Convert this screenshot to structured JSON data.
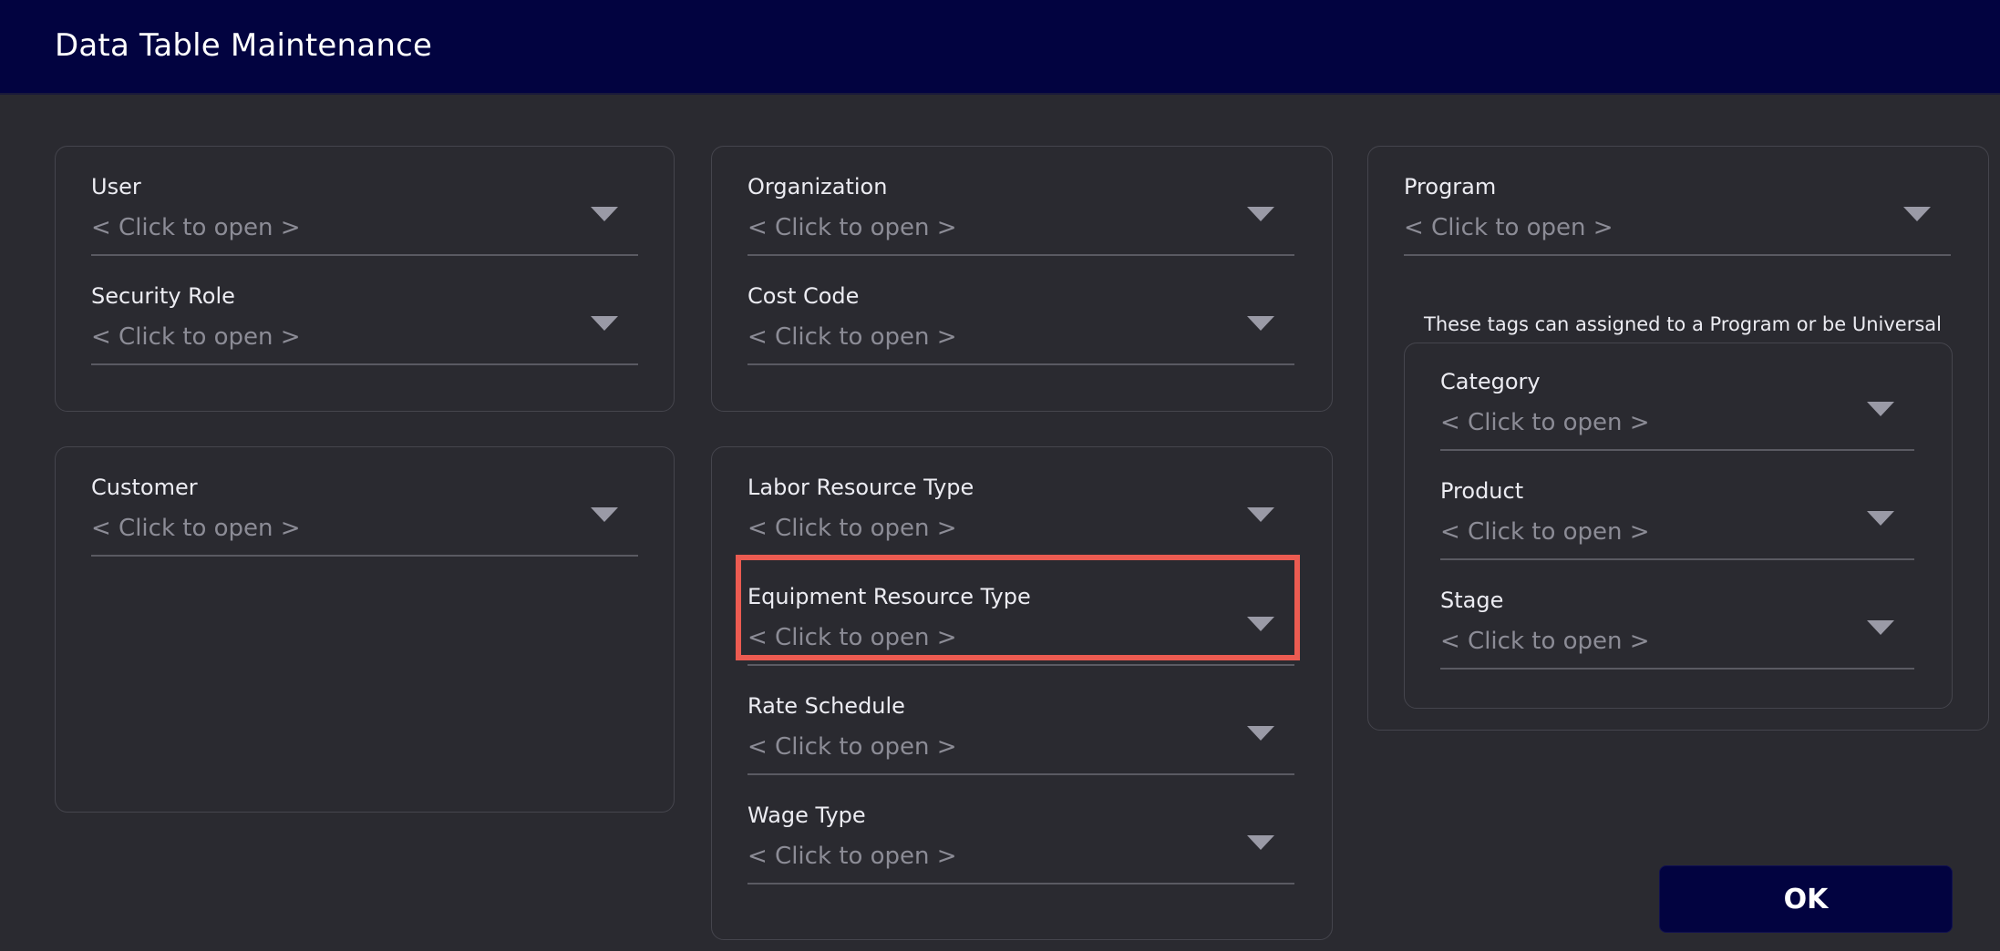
{
  "dialog": {
    "title": "Data Table Maintenance"
  },
  "fields": {
    "user": {
      "label": "User",
      "value": "< Click to open >"
    },
    "security_role": {
      "label": "Security Role",
      "value": "< Click to open >"
    },
    "customer": {
      "label": "Customer",
      "value": "< Click to open >"
    },
    "organization": {
      "label": "Organization",
      "value": "< Click to open >"
    },
    "cost_code": {
      "label": "Cost Code",
      "value": "< Click to open >"
    },
    "labor_resource_type": {
      "label": "Labor Resource Type",
      "value": "< Click to open >"
    },
    "equipment_resource_type": {
      "label": "Equipment Resource Type",
      "value": "< Click to open >"
    },
    "rate_schedule": {
      "label": "Rate Schedule",
      "value": "< Click to open >"
    },
    "wage_type": {
      "label": "Wage Type",
      "value": "< Click to open >"
    },
    "program": {
      "label": "Program",
      "value": "< Click to open >"
    },
    "category": {
      "label": "Category",
      "value": "< Click to open >"
    },
    "product": {
      "label": "Product",
      "value": "< Click to open >"
    },
    "stage": {
      "label": "Stage",
      "value": "< Click to open >"
    }
  },
  "tags_note": "These tags can assigned to a Program or be Universal",
  "buttons": {
    "ok": "OK"
  },
  "colors": {
    "title_bar": "#020340",
    "background": "#2a2a30",
    "highlight": "#ec5b51"
  }
}
